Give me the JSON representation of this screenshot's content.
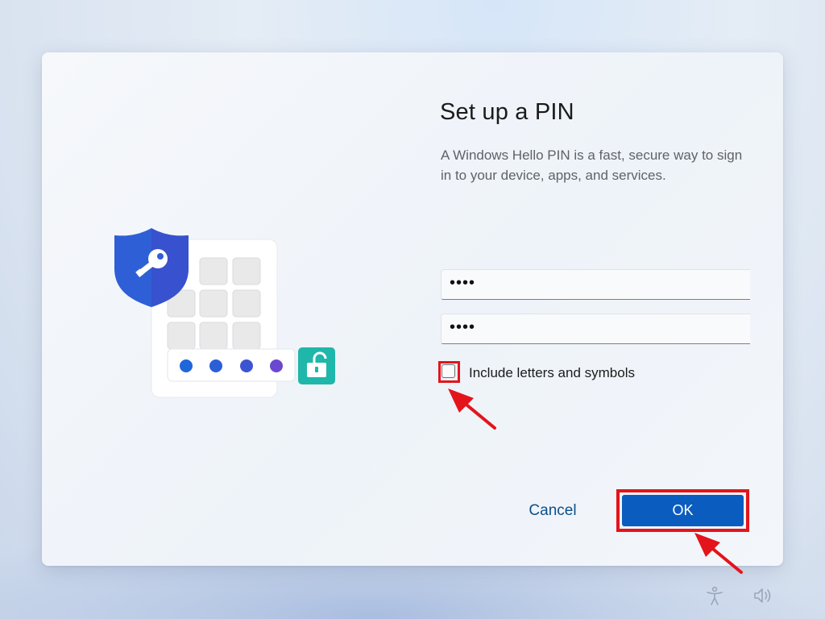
{
  "dialog": {
    "title": "Set up a PIN",
    "description": "A Windows Hello PIN is a fast, secure way to sign in to your device, apps, and services.",
    "pin_field": {
      "value": "••••"
    },
    "confirm_pin_field": {
      "value": "••••"
    },
    "checkbox": {
      "label": "Include letters and symbols",
      "checked": false
    },
    "cancel_label": "Cancel",
    "ok_label": "OK"
  },
  "annotations": {
    "highlight_color": "#e4141b"
  },
  "colors": {
    "primary_button": "#0b5cbf",
    "link": "#0b4f8a",
    "shield": "#2f5fd6",
    "lock": "#22c1b0"
  },
  "taskbar": {
    "icons": [
      "accessibility-icon",
      "volume-icon"
    ]
  }
}
